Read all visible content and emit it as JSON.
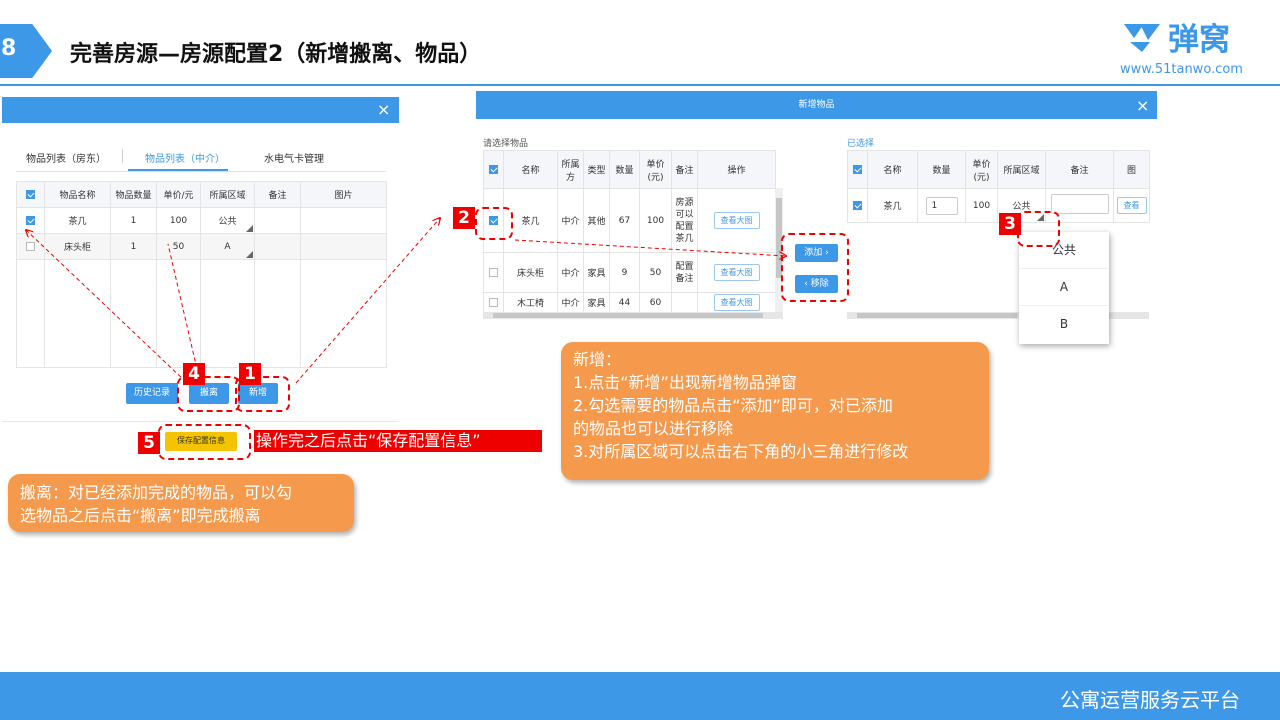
{
  "slide": {
    "page_number": "8",
    "title": "完善房源—房源配置2（新增搬离、物品）",
    "logo_text": "弹窝",
    "logo_url": "www.51tanwo.com",
    "footer": "公寓运营服务云平台"
  },
  "left_modal": {
    "close": "×",
    "tabs": [
      "物品列表（房东）",
      "物品列表（中介）",
      "水电气卡管理"
    ],
    "active_tab": 1,
    "columns": [
      "物品名称",
      "物品数量",
      "单价/元",
      "所属区域",
      "备注",
      "图片"
    ],
    "rows": [
      {
        "checked": true,
        "name": "茶几",
        "qty": "1",
        "price": "100",
        "area": "公共",
        "note": "",
        "image": ""
      },
      {
        "checked": false,
        "name": "床头柜",
        "qty": "1",
        "price": "50",
        "area": "A",
        "note": "",
        "image": ""
      }
    ],
    "buttons": {
      "history": "历史记录",
      "move_out": "搬离",
      "add_new": "新增",
      "save": "保存配置信息"
    }
  },
  "right_modal": {
    "title": "新增物品",
    "close": "×",
    "left_label": "请选择物品",
    "left_columns": [
      "名称",
      "所属方",
      "类型",
      "数量",
      "单价(元)",
      "备注",
      "操作"
    ],
    "left_rows": [
      {
        "checked": true,
        "name": "茶几",
        "owner": "中介",
        "type": "其他",
        "qty": "67",
        "price": "100",
        "note": "房源可以配置茶几",
        "action": "查看大图"
      },
      {
        "checked": false,
        "name": "床头柜",
        "owner": "中介",
        "type": "家具",
        "qty": "9",
        "price": "50",
        "note": "配置备注",
        "action": "查看大图"
      },
      {
        "checked": false,
        "name": "木工椅",
        "owner": "中介",
        "type": "家具",
        "qty": "44",
        "price": "60",
        "note": "",
        "action": "查看大图"
      }
    ],
    "add_button": "添加 ›",
    "remove_button": "‹ 移除",
    "right_label": "已选择",
    "right_columns": [
      "名称",
      "数量",
      "单价(元)",
      "所属区域",
      "备注",
      "图"
    ],
    "right_rows": [
      {
        "checked": true,
        "name": "茶几",
        "qty": "1",
        "price": "100",
        "area": "公共",
        "action": "查看"
      }
    ],
    "dropdown_options": [
      "公共",
      "A",
      "B"
    ]
  },
  "annotations": {
    "badges": [
      "1",
      "2",
      "3",
      "4",
      "5"
    ],
    "save_hint": "操作完之后点击“保存配置信息”",
    "callout_add": [
      "新增：",
      "1.点击“新增”出现新增物品弹窗",
      "2.勾选需要的物品点击“添加”即可，对已添加",
      "的物品也可以进行移除",
      "3.对所属区域可以点击右下角的小三角进行修改"
    ],
    "callout_move": [
      "搬离：对已经添加完成的物品，可以勾",
      "选物品之后点击“搬离”即完成搬离"
    ]
  },
  "colors": {
    "accent": "#3d98e8",
    "annotation_red": "#e00000",
    "callout_orange": "#f59a4d",
    "save_yellow": "#f5c400"
  }
}
